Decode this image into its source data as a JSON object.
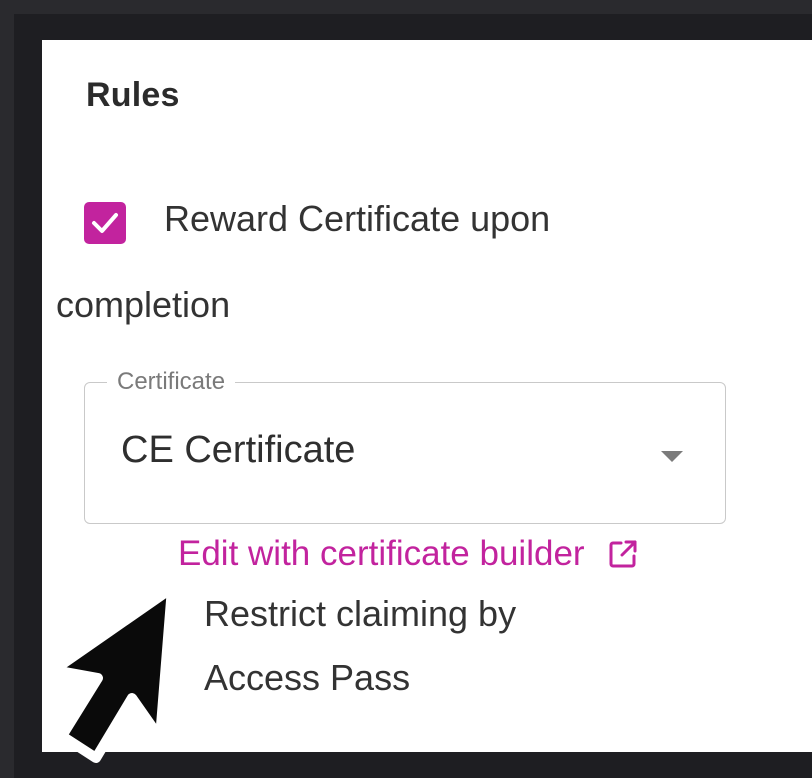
{
  "section": {
    "title": "Rules"
  },
  "certificate_option": {
    "checked": true,
    "label_line1": "Reward Certificate upon",
    "label_line2": "completion",
    "checkbox_color": "#c2239e"
  },
  "certificate_select": {
    "legend": "Certificate",
    "value": "CE Certificate"
  },
  "edit_link": {
    "label": "Edit with certificate builder",
    "icon": "external-link-icon",
    "color": "#c2239e"
  },
  "restrict_option": {
    "label_line1": "Restrict claiming by",
    "label_line2": "Access Pass"
  },
  "pointer": {
    "icon": "mouse-pointer-icon"
  }
}
